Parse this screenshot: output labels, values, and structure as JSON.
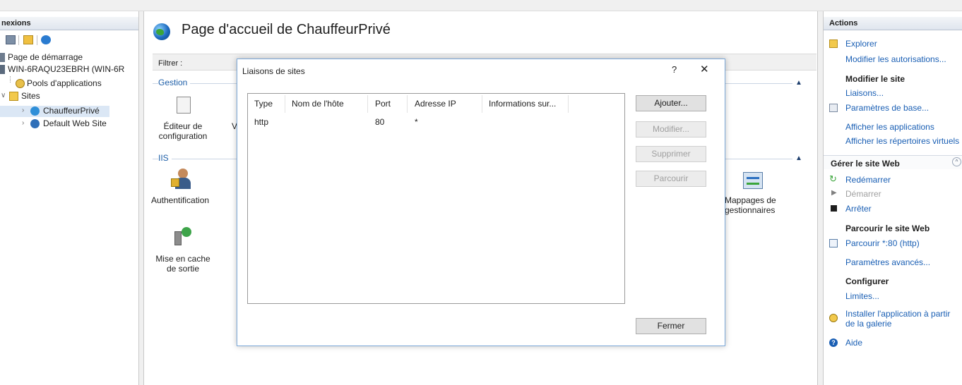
{
  "connections": {
    "title": "nexions",
    "tree": [
      {
        "label": "Page de démarrage"
      },
      {
        "label": "WIN-6RAQU23EBRH (WIN-6R"
      },
      {
        "label": "Pools d'applications"
      },
      {
        "label": "Sites"
      },
      {
        "label": "ChauffeurPrivé"
      },
      {
        "label": "Default Web Site"
      }
    ]
  },
  "center": {
    "title": "Page d'accueil de ChauffeurPrivé",
    "filter_label": "Filtrer :",
    "groups": {
      "gestion": "Gestion",
      "iis": "IIS"
    },
    "features": {
      "editeur": "Éditeur de configuration",
      "editeur_next": "V",
      "auth": "Authentification",
      "cache": "Mise en cache de sortie",
      "mappages": "Mappages de gestionnaires"
    }
  },
  "dialog": {
    "title": "Liaisons de sites",
    "help": "?",
    "close": "✕",
    "columns": [
      "Type",
      "Nom de l'hôte",
      "Port",
      "Adresse IP",
      "Informations sur..."
    ],
    "rows": [
      {
        "type": "http",
        "host": "",
        "port": "80",
        "ip": "*",
        "info": ""
      }
    ],
    "buttons": {
      "add": "Ajouter...",
      "edit": "Modifier...",
      "remove": "Supprimer",
      "browse": "Parcourir",
      "close": "Fermer"
    }
  },
  "actions": {
    "title": "Actions",
    "explore": "Explorer",
    "edit_permissions": "Modifier les autorisations...",
    "edit_site_head": "Modifier le site",
    "bindings": "Liaisons...",
    "basic_settings": "Paramètres de base...",
    "view_apps": "Afficher les applications",
    "view_vdirs": "Afficher les répertoires virtuels",
    "manage_head": "Gérer le site Web",
    "restart": "Redémarrer",
    "start": "Démarrer",
    "stop": "Arrêter",
    "browse_head": "Parcourir le site Web",
    "browse_80": "Parcourir *:80 (http)",
    "advanced": "Paramètres avancés...",
    "configure_head": "Configurer",
    "limits": "Limites...",
    "install_gallery": "Installer l'application à partir de la galerie",
    "help": "Aide"
  },
  "colors": {
    "link": "#1a5fb4",
    "group_title": "#1e5fa8",
    "dialog_border": "#7aa7d8",
    "disabled_text": "#a0a0a0"
  }
}
